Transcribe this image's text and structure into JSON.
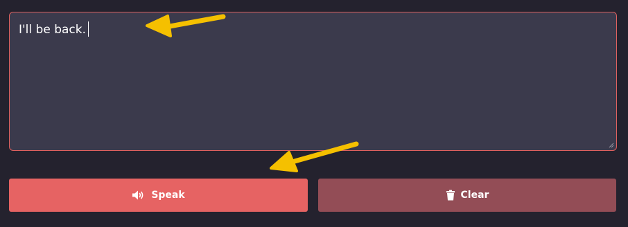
{
  "editor": {
    "text": "I'll be back.",
    "border_color": "#e0615f",
    "background": "#3b3a4c"
  },
  "buttons": {
    "speak_label": "Speak",
    "speak_icon": "volume-icon",
    "clear_label": "Clear",
    "clear_icon": "trash-icon"
  },
  "colors": {
    "page_background": "#24222e",
    "speak_button": "#e66363",
    "clear_button": "#934d56",
    "annotation_arrow": "#f5c000"
  }
}
